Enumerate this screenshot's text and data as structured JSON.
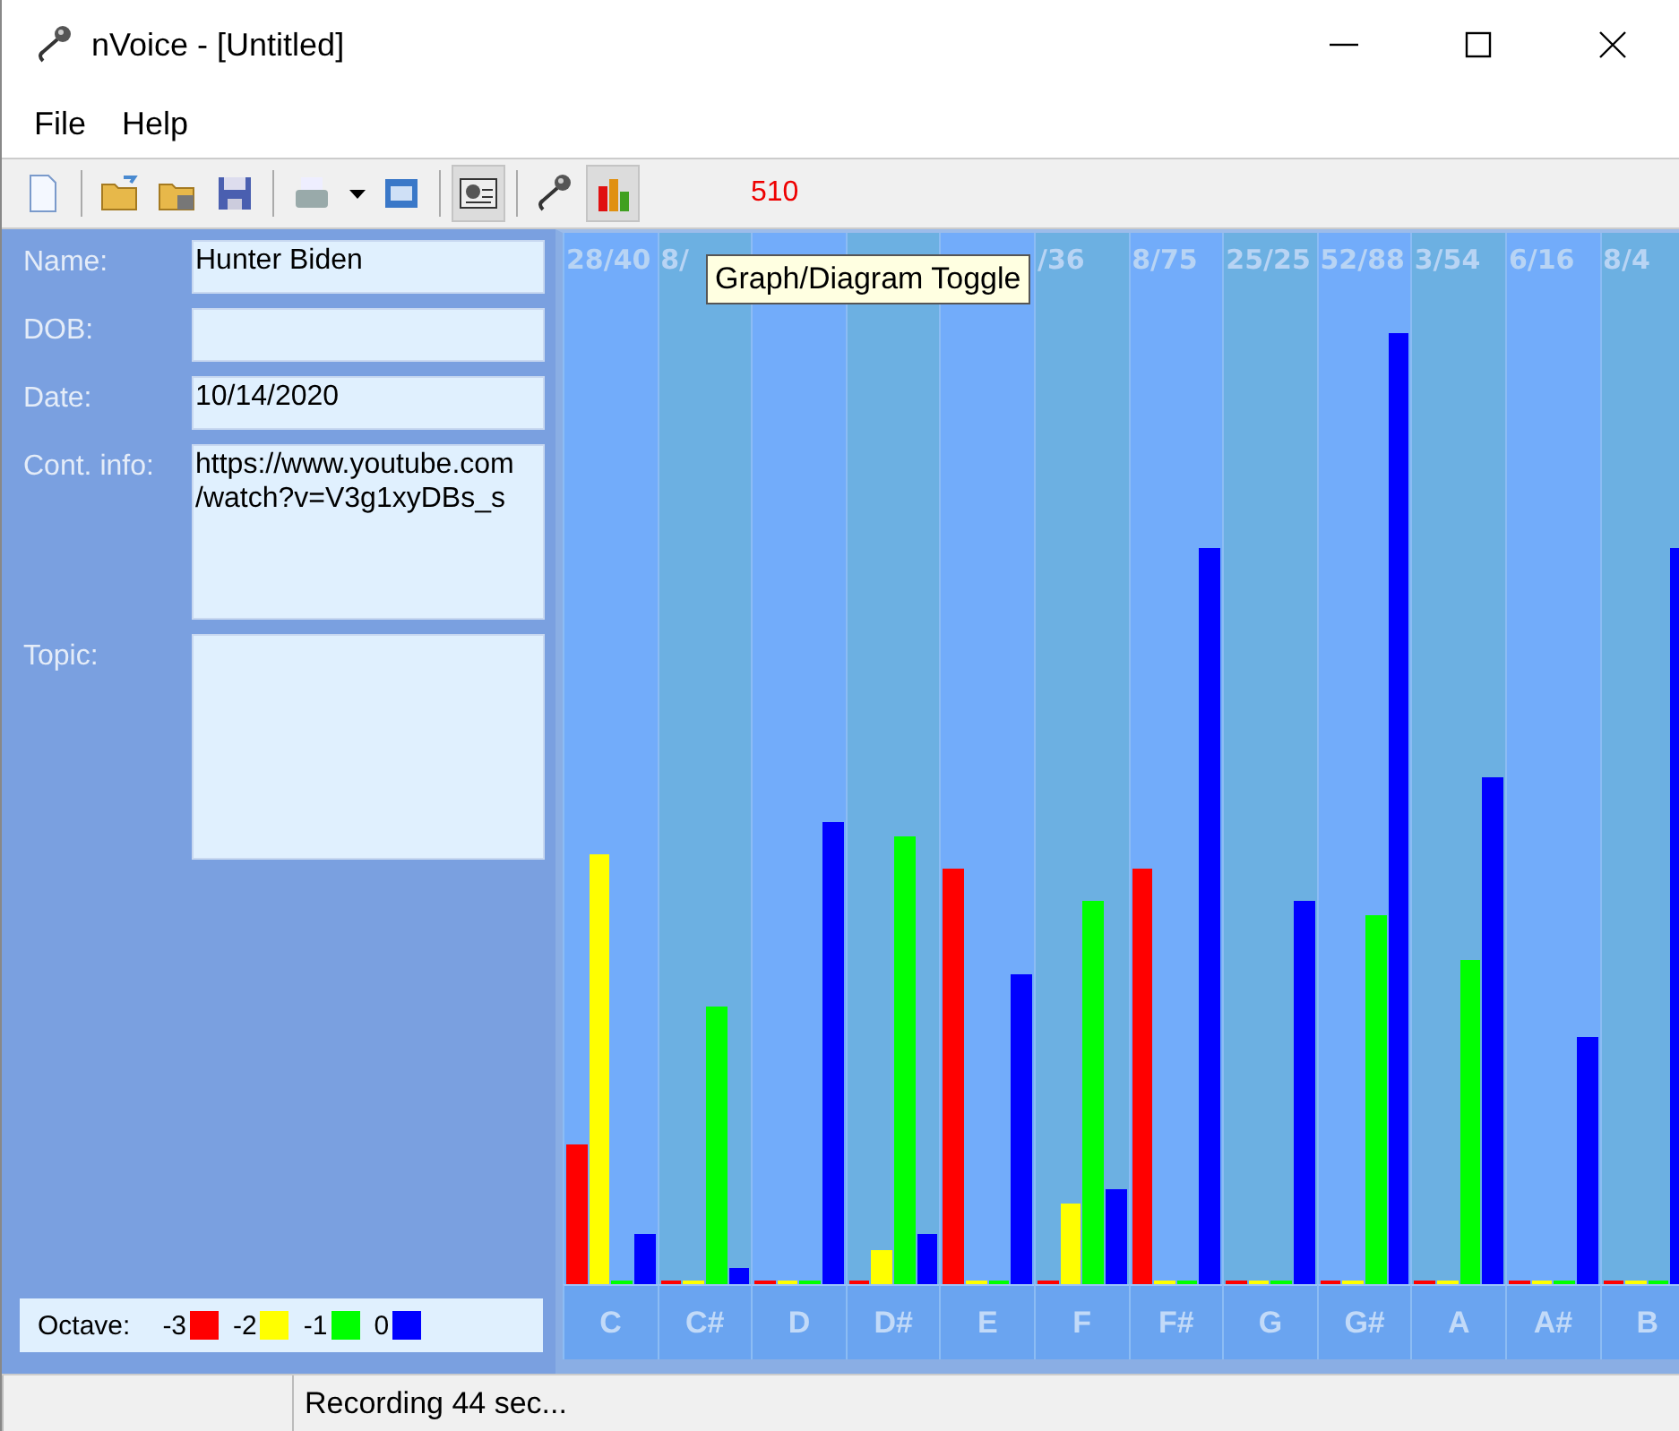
{
  "window": {
    "title": "nVoice - [Untitled]"
  },
  "menu": [
    "File",
    "Help"
  ],
  "toolbar": {
    "buttons": [
      {
        "kind": "new",
        "selected": false
      },
      {
        "kind": "sep"
      },
      {
        "kind": "open",
        "selected": false
      },
      {
        "kind": "openspecial",
        "selected": false
      },
      {
        "kind": "save",
        "selected": false
      },
      {
        "kind": "sep"
      },
      {
        "kind": "print",
        "selected": false
      },
      {
        "kind": "dropdown",
        "selected": false
      },
      {
        "kind": "window",
        "selected": false
      },
      {
        "kind": "sep"
      },
      {
        "kind": "card",
        "selected": true
      },
      {
        "kind": "sep"
      },
      {
        "kind": "mic",
        "selected": false
      },
      {
        "kind": "bars",
        "selected": true
      }
    ],
    "counter": "510"
  },
  "form": [
    {
      "label": "Name:",
      "value": "Hunter Biden",
      "kind": "line"
    },
    {
      "label": "DOB:",
      "kind": "line"
    },
    {
      "label": "Date:",
      "value": "10/14/2020",
      "kind": "line"
    },
    {
      "label": "Cont. info:",
      "value": "https://www.youtube.com\n/watch?v=V3g1xyDBs_s",
      "kind": "area"
    },
    {
      "label": "Topic:",
      "kind": "area"
    }
  ],
  "legend": {
    "label": "Octave:",
    "items": [
      {
        "label": "-3",
        "color": "#ff0000"
      },
      {
        "label": "-2",
        "color": "#ffff00"
      },
      {
        "label": "-1",
        "color": "#00ff00"
      },
      {
        "label": "0",
        "color": "#0000ff"
      }
    ]
  },
  "columns": [
    {
      "note": "C",
      "ratio": "28/40"
    },
    {
      "note": "C#",
      "ratio": "8/"
    },
    {
      "note": "D"
    },
    {
      "note": "D#"
    },
    {
      "note": "E"
    },
    {
      "note": "F",
      "ratio": "/36"
    },
    {
      "note": "F#",
      "ratio": "8/75"
    },
    {
      "note": "G",
      "ratio": "25/25"
    },
    {
      "note": "G#",
      "ratio": "52/88"
    },
    {
      "note": "A",
      "ratio": "3/54"
    },
    {
      "note": "A#",
      "ratio": "6/16"
    },
    {
      "note": "B",
      "ratio": "8/4"
    }
  ],
  "tooltip": "Graph/Diagram Toggle",
  "status_bar": {
    "text": "Recording 44 sec..."
  }
}
